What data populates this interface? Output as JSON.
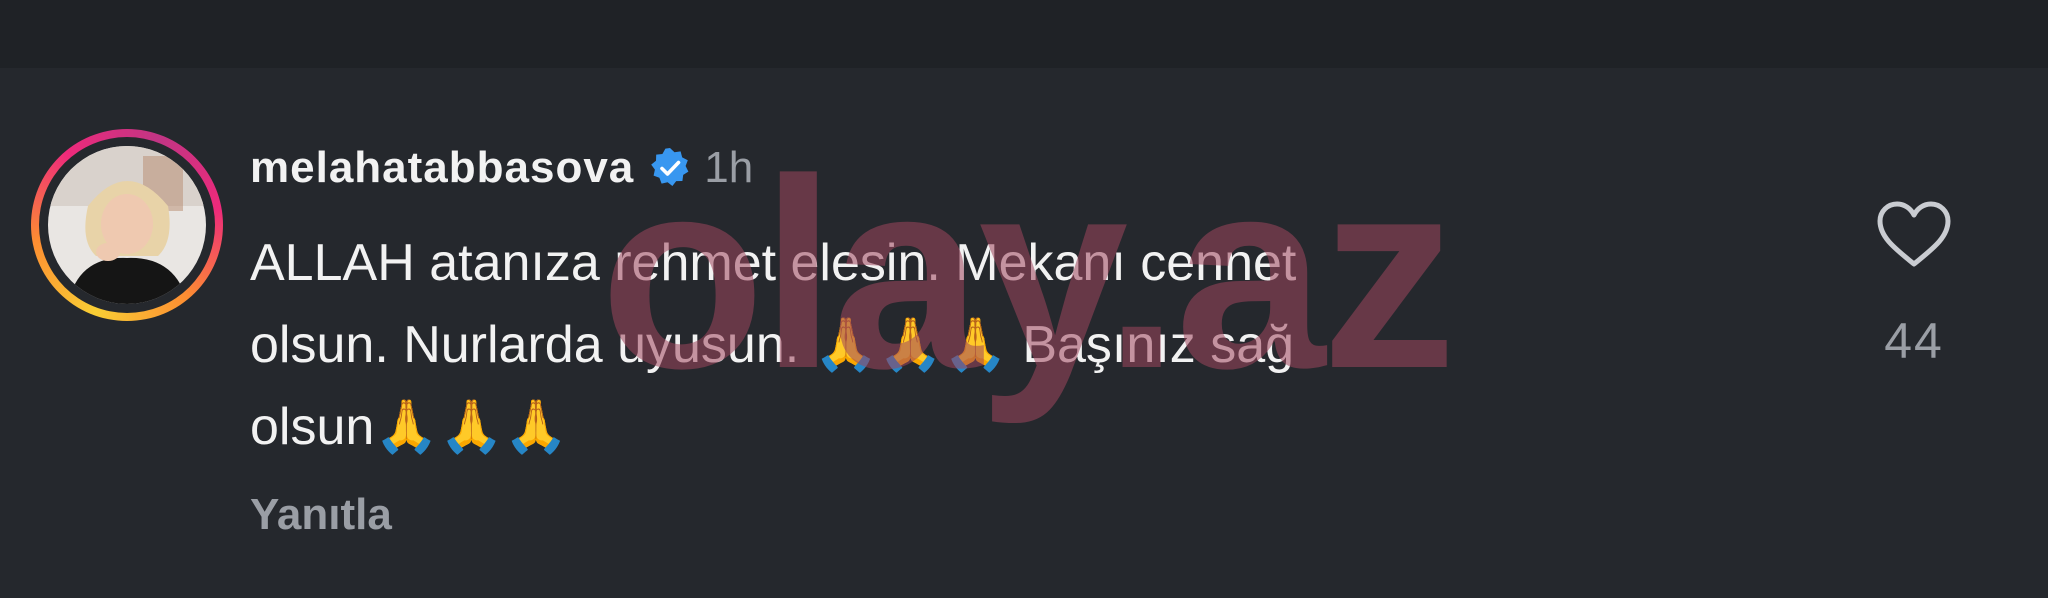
{
  "comment": {
    "username": "melahatabbasova",
    "verified_icon": "verified-badge-icon",
    "time_ago": "1h",
    "text_lines": [
      "ALLAH atanıza rehmet elesin. Mekanı cennet",
      "olsun. Nurlarda uyusun. 🙏🙏🙏 Başınız sağ",
      "olsun🙏🙏🙏"
    ],
    "reply_label": "Yanıtla",
    "like_icon": "heart-icon",
    "like_count": "44"
  },
  "watermark": {
    "text": "olay.az"
  },
  "colors": {
    "background": "#25282d",
    "text": "#f2f2f2",
    "muted_text": "#9a9ea5",
    "verified_blue": "#3897f0",
    "watermark": "#9e465c"
  }
}
